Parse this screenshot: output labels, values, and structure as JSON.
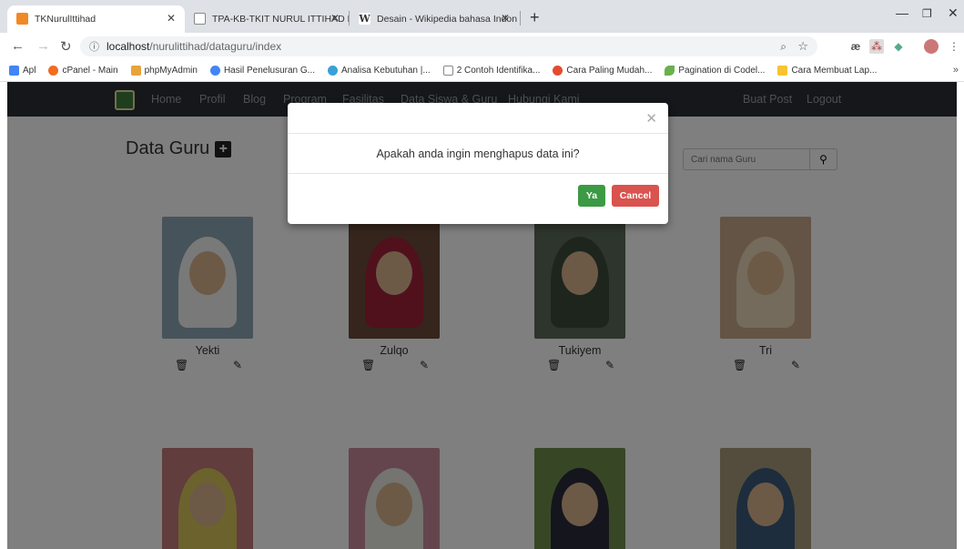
{
  "browser": {
    "tabs": [
      {
        "title": "TKNurulIttihad",
        "active": true,
        "favicon_color": "#f08a24"
      },
      {
        "title": "TPA-KB-TKIT NURUL ITTIHAD Ma",
        "active": false,
        "favicon_color": "#888888"
      },
      {
        "title": "Desain - Wikipedia bahasa Indon",
        "active": false,
        "favicon_color": "#333333"
      }
    ],
    "url_host": "localhost",
    "url_path": "/nurulittihad/dataguru/index",
    "bookmarks": [
      {
        "label": "Apl",
        "color": "#4285f4"
      },
      {
        "label": "cPanel - Main",
        "color": "#f26b21"
      },
      {
        "label": "phpMyAdmin",
        "color": "#e8a33b"
      },
      {
        "label": "Hasil Penelusuran G...",
        "color": "#4285f4"
      },
      {
        "label": "Analisa Kebutuhan |...",
        "color": "#3aa0d8"
      },
      {
        "label": "2 Contoh Identifika...",
        "color": "#888888"
      },
      {
        "label": "Cara Paling Mudah...",
        "color": "#e44b2e"
      },
      {
        "label": "Pagination di Codel...",
        "color": "#6ab04c"
      },
      {
        "label": "Cara Membuat Lap...",
        "color": "#f7c331"
      }
    ]
  },
  "site": {
    "nav": [
      "Home",
      "Profil",
      "Blog",
      "Program",
      "Fasilitas",
      "Data Siswa & Guru",
      "Hubungi Kami"
    ],
    "nav_right": [
      "Buat Post",
      "Logout"
    ],
    "page_title": "Data Guru",
    "search_placeholder": "Cari nama Guru",
    "teachers": [
      {
        "name": "Yekti",
        "bg": "#8fa6b5",
        "hijab": "#f2f2f2"
      },
      {
        "name": "Zulqo",
        "bg": "#6a4a3a",
        "hijab": "#a0223a"
      },
      {
        "name": "Tukiyem",
        "bg": "#5c6b58",
        "hijab": "#3d4a3a"
      },
      {
        "name": "Tri",
        "bg": "#c9a98d",
        "hijab": "#e8d7b8"
      },
      {
        "name": "",
        "bg": "#c27a7a",
        "hijab": "#d9c45a"
      },
      {
        "name": "",
        "bg": "#c98a9a",
        "hijab": "#e8e8e0"
      },
      {
        "name": "",
        "bg": "#6e8f4a",
        "hijab": "#2a2a3a"
      },
      {
        "name": "",
        "bg": "#a89a7a",
        "hijab": "#3a5a7a"
      }
    ]
  },
  "modal": {
    "message": "Apakah anda ingin menghapus data ini?",
    "confirm_label": "Ya",
    "cancel_label": "Cancel"
  }
}
